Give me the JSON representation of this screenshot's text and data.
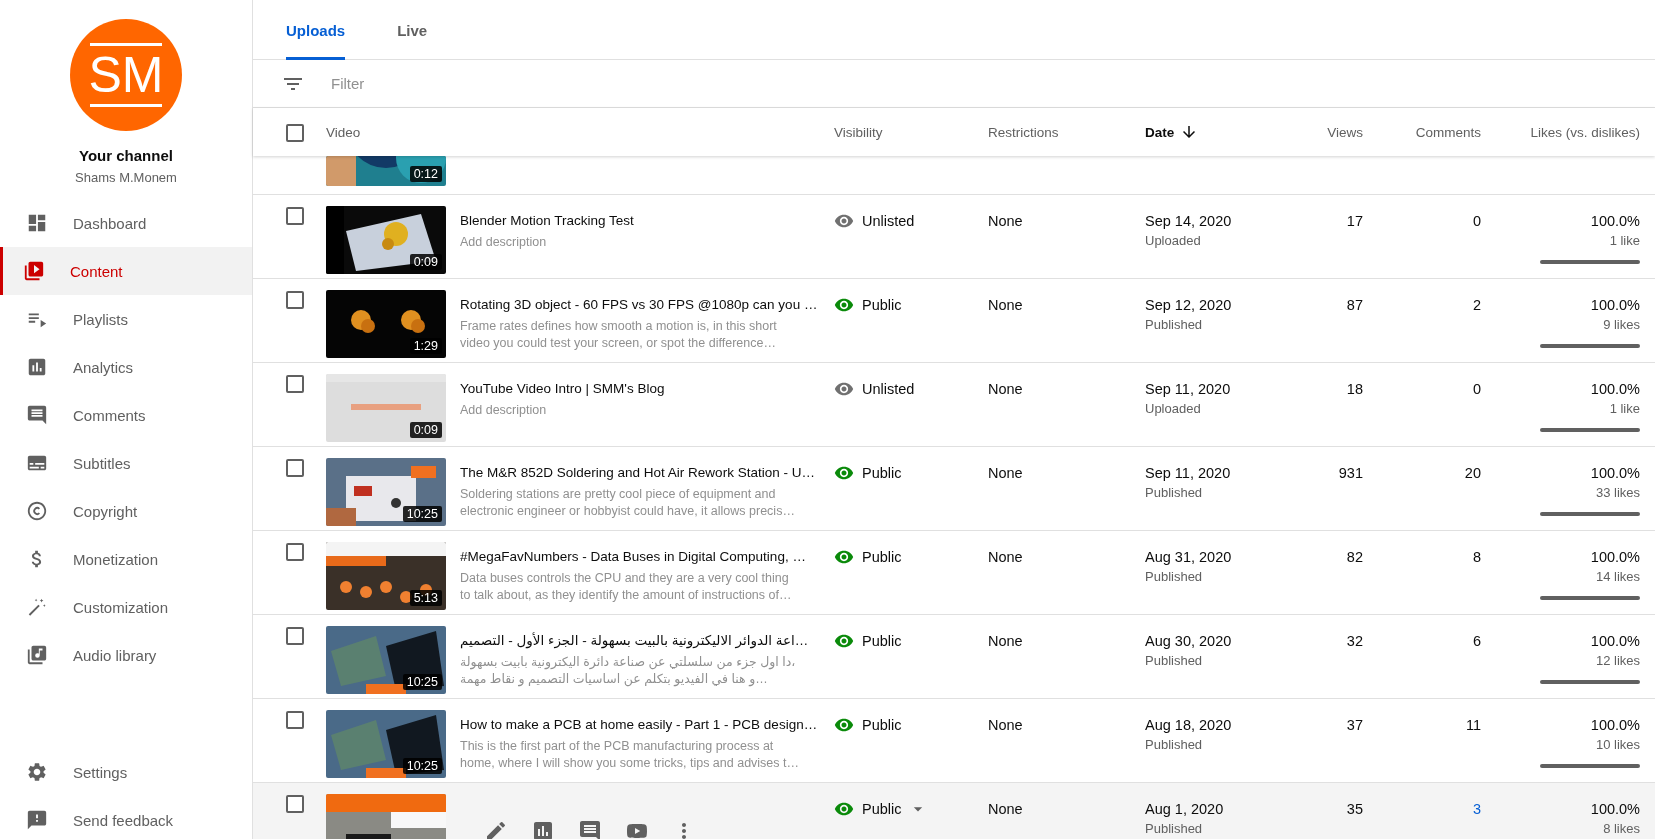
{
  "sidebar": {
    "avatar_initials": "SM",
    "channel_title": "Your channel",
    "channel_name": "Shams M.Monem",
    "nav": [
      {
        "label": "Dashboard",
        "selected": false
      },
      {
        "label": "Content",
        "selected": true
      },
      {
        "label": "Playlists",
        "selected": false
      },
      {
        "label": "Analytics",
        "selected": false
      },
      {
        "label": "Comments",
        "selected": false
      },
      {
        "label": "Subtitles",
        "selected": false
      },
      {
        "label": "Copyright",
        "selected": false
      },
      {
        "label": "Monetization",
        "selected": false
      },
      {
        "label": "Customization",
        "selected": false
      },
      {
        "label": "Audio library",
        "selected": false
      }
    ],
    "footer": [
      {
        "label": "Settings"
      },
      {
        "label": "Send feedback"
      }
    ]
  },
  "tabs": [
    {
      "label": "Uploads",
      "selected": true
    },
    {
      "label": "Live",
      "selected": false
    }
  ],
  "filter": {
    "placeholder": "Filter"
  },
  "table": {
    "select_all_checked": false,
    "columns": [
      {
        "label": "Video",
        "sorted": false
      },
      {
        "label": "Visibility",
        "sorted": false
      },
      {
        "label": "Restrictions",
        "sorted": false
      },
      {
        "label": "Date",
        "sorted": true
      },
      {
        "label": "Views",
        "sorted": false
      },
      {
        "label": "Comments",
        "sorted": false
      },
      {
        "label": "Likes (vs. dislikes)",
        "sorted": false
      }
    ],
    "partial_row": {
      "duration": "0:12"
    },
    "rows": [
      {
        "checked": false,
        "hovered": false,
        "title": "Blender Motion Tracking Test",
        "description_lines": [
          "Add description"
        ],
        "duration": "0:09",
        "visibility": {
          "label": "Unlisted",
          "kind": "unlisted"
        },
        "restrictions": "None",
        "date": "Sep 14, 2020",
        "date_status": "Uploaded",
        "views": "17",
        "comments": "0",
        "likes_percent": "100.0%",
        "likes_count": "1 like",
        "level": 1
      },
      {
        "checked": false,
        "hovered": false,
        "title": "Rotating 3D object - 60 FPS vs 30 FPS @1080p can you …",
        "description_lines": [
          "Frame rates defines how smooth a motion is, in this short",
          "video you could test your screen, or spot the difference…"
        ],
        "duration": "1:29",
        "visibility": {
          "label": "Public",
          "kind": "public"
        },
        "restrictions": "None",
        "date": "Sep 12, 2020",
        "date_status": "Published",
        "views": "87",
        "comments": "2",
        "likes_percent": "100.0%",
        "likes_count": "9 likes",
        "level": 1
      },
      {
        "checked": false,
        "hovered": false,
        "title": "YouTube Video Intro | SMM's Blog",
        "description_lines": [
          "Add description"
        ],
        "duration": "0:09",
        "visibility": {
          "label": "Unlisted",
          "kind": "unlisted"
        },
        "restrictions": "None",
        "date": "Sep 11, 2020",
        "date_status": "Uploaded",
        "views": "18",
        "comments": "0",
        "likes_percent": "100.0%",
        "likes_count": "1 like",
        "level": 1
      },
      {
        "checked": false,
        "hovered": false,
        "title": "The M&R 852D Soldering and Hot Air Rework Station - U…",
        "description_lines": [
          "Soldering stations are pretty cool piece of equipment and",
          "electronic engineer or hobbyist could have, it allows precis…"
        ],
        "duration": "10:25",
        "visibility": {
          "label": "Public",
          "kind": "public"
        },
        "restrictions": "None",
        "date": "Sep 11, 2020",
        "date_status": "Published",
        "views": "931",
        "comments": "20",
        "likes_percent": "100.0%",
        "likes_count": "33 likes",
        "level": 1
      },
      {
        "checked": false,
        "hovered": false,
        "title": "#MegaFavNumbers - Data Buses in Digital Computing, …",
        "description_lines": [
          "Data buses controls the CPU and they are a very cool thing",
          "to talk about, as they identify the amount of instructions of…"
        ],
        "duration": "5:13",
        "visibility": {
          "label": "Public",
          "kind": "public"
        },
        "restrictions": "None",
        "date": "Aug 31, 2020",
        "date_status": "Published",
        "views": "82",
        "comments": "8",
        "likes_percent": "100.0%",
        "likes_count": "14 likes",
        "level": 1
      },
      {
        "checked": false,
        "hovered": false,
        "title": "اعة الدوائر الاليكترونية بالبيت بسهولة - الجزء الأول - التصميم…",
        "description_lines": [
          "دا اول جزء من سلسلتي عن صناعة دائرة اليكترونية بابيت بسهولة،",
          "و هنا في الفيديو بتكلم عن اساسيات التصميم و نقاط مهمة…"
        ],
        "duration": "10:25",
        "visibility": {
          "label": "Public",
          "kind": "public"
        },
        "restrictions": "None",
        "date": "Aug 30, 2020",
        "date_status": "Published",
        "views": "32",
        "comments": "6",
        "likes_percent": "100.0%",
        "likes_count": "12 likes",
        "level": 1
      },
      {
        "checked": false,
        "hovered": false,
        "title": "How to make a PCB at home easily - Part 1 - PCB design…",
        "description_lines": [
          "This is the first part of the PCB manufacturing process at",
          "home, where I will show you some tricks, tips and advises t…"
        ],
        "duration": "10:25",
        "visibility": {
          "label": "Public",
          "kind": "public"
        },
        "restrictions": "None",
        "date": "Aug 18, 2020",
        "date_status": "Published",
        "views": "37",
        "comments": "11",
        "likes_percent": "100.0%",
        "likes_count": "10 likes",
        "level": 1
      },
      {
        "checked": false,
        "hovered": true,
        "visibility": {
          "label": "Public",
          "kind": "public"
        },
        "restrictions": "None",
        "date": "Aug 1, 2020",
        "date_status": "Published",
        "views": "35",
        "comments": "3",
        "likes_percent": "100.0%",
        "likes_count": "8 likes"
      }
    ]
  }
}
